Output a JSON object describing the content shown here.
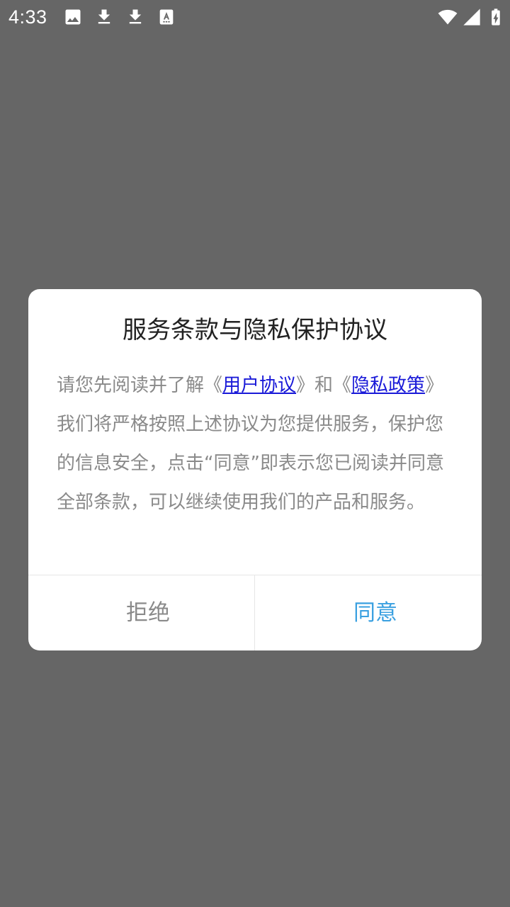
{
  "status_bar": {
    "time": "4:33",
    "left_icons": [
      "image-icon",
      "download-icon",
      "download-icon",
      "text-recognition-icon"
    ],
    "right_icons": [
      "wifi-icon",
      "cellular-signal-icon",
      "battery-charging-icon"
    ]
  },
  "dialog": {
    "title": "服务条款与隐私保护协议",
    "body": {
      "prefix": "请您先阅读并了解《",
      "user_agreement_link": "用户协议",
      "middle": "》和《",
      "privacy_policy_link": "隐私政策",
      "suffix": "》我们将严格按照上述协议为您提供服务，保护您的信息安全，点击“同意”即表示您已阅读并同意全部条款，可以继续使用我们的产品和服务。"
    },
    "buttons": {
      "reject": "拒绝",
      "agree": "同意"
    }
  },
  "colors": {
    "overlay": "#666666",
    "link": "#1a1ad8",
    "agree": "#3aa0e0",
    "body_text": "#8a8a8a"
  }
}
